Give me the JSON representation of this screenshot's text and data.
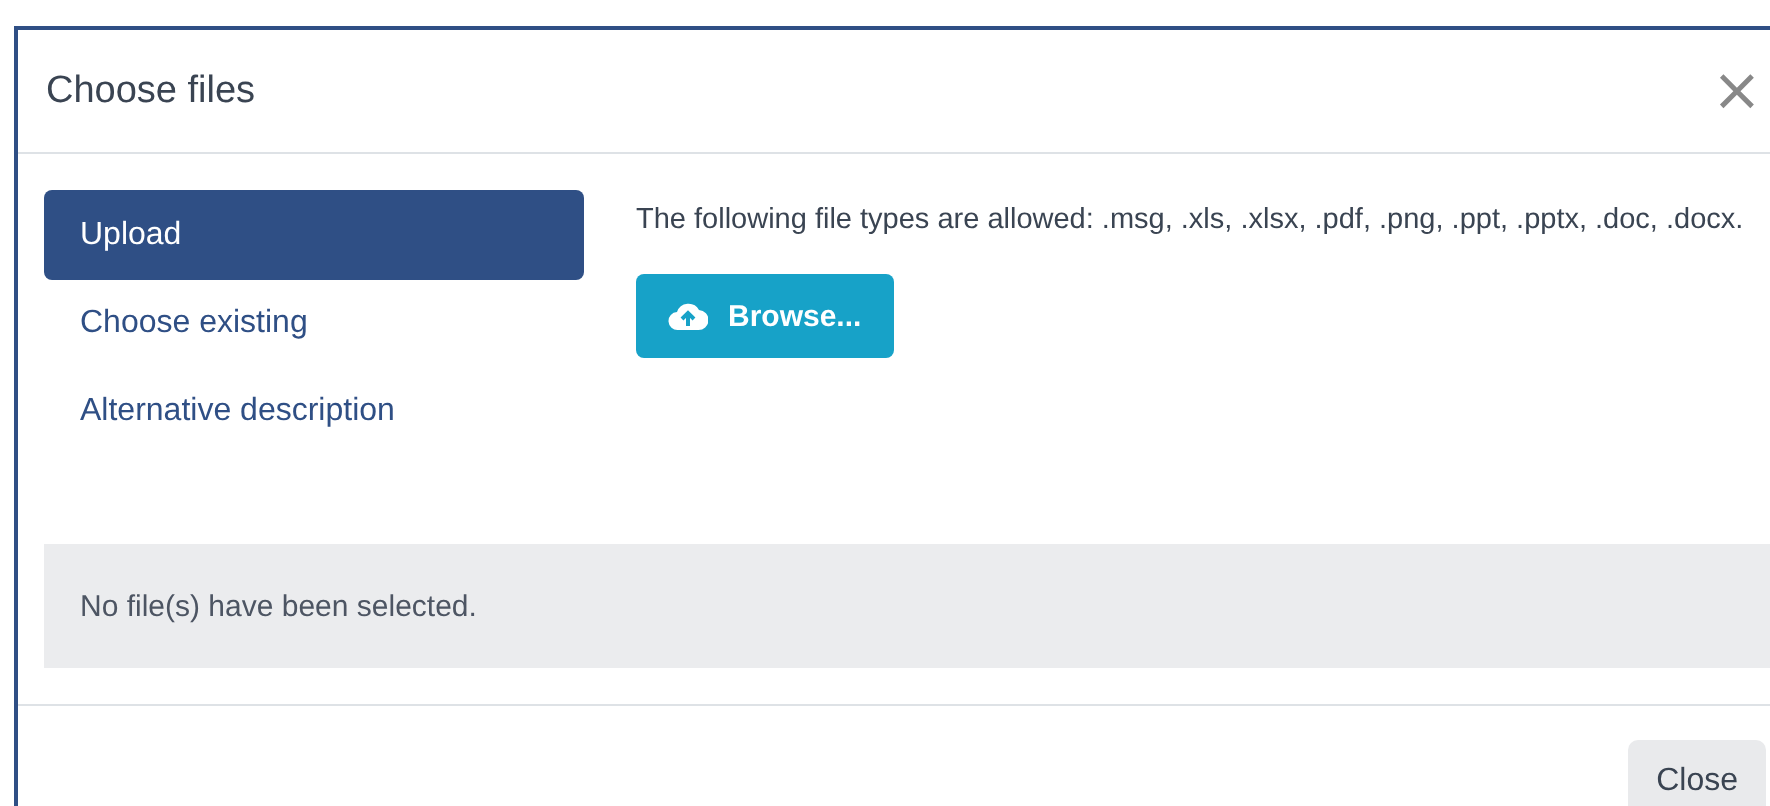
{
  "dialog": {
    "title": "Choose files",
    "close_icon": "×"
  },
  "tabs": [
    {
      "label": "Upload",
      "selected": true
    },
    {
      "label": "Choose existing",
      "selected": false
    },
    {
      "label": "Alternative description",
      "selected": false
    }
  ],
  "allowed_types": "The following file types are allowed: .msg, .xls, .xlsx, .pdf, .png, .ppt, .pptx, .doc, .docx.",
  "browse_button": "Browse...",
  "status": "No file(s) have been selected.",
  "buttons": [
    "Close"
  ]
}
